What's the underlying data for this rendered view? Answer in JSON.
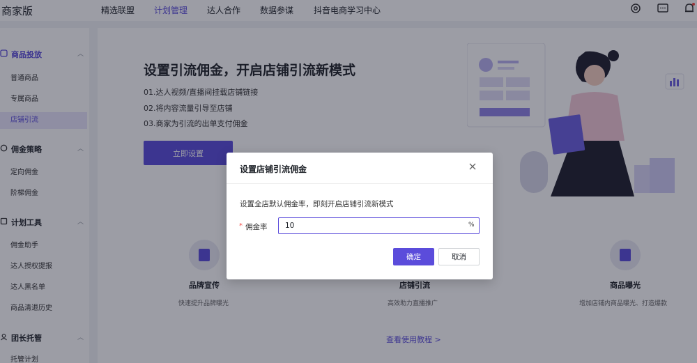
{
  "brand": "商家版",
  "nav": {
    "items": [
      {
        "label": "精选联盟",
        "active": false
      },
      {
        "label": "计划管理",
        "active": true
      },
      {
        "label": "达人合作",
        "active": false
      },
      {
        "label": "数据参谋",
        "active": false
      },
      {
        "label": "抖音电商学习中心",
        "active": false
      }
    ],
    "icons": [
      "gear-icon",
      "message-icon",
      "bell-icon"
    ]
  },
  "sidebar": {
    "groups": [
      {
        "label": "商品投放",
        "icon": "product-icon",
        "active": true,
        "items": [
          {
            "label": "普通商品"
          },
          {
            "label": "专属商品"
          },
          {
            "label": "店铺引流",
            "active": true
          }
        ]
      },
      {
        "label": "佣金策略",
        "icon": "commission-icon",
        "items": [
          {
            "label": "定向佣金"
          },
          {
            "label": "阶梯佣金"
          }
        ]
      },
      {
        "label": "计划工具",
        "icon": "tool-icon",
        "items": [
          {
            "label": "佣金助手"
          },
          {
            "label": "达人授权提报"
          },
          {
            "label": "达人黑名单"
          },
          {
            "label": "商品清退历史"
          }
        ]
      },
      {
        "label": "团长托管",
        "icon": "group-icon",
        "items": [
          {
            "label": "托管计划"
          }
        ]
      }
    ]
  },
  "hero": {
    "title": "设置引流佣金，开启店铺引流新模式",
    "steps": [
      "01.达人视频/直播间挂载店铺链接",
      "02.将内容流量引导至店铺",
      "03.商家为引流的出单支付佣金"
    ],
    "cta": "立即设置"
  },
  "features": [
    {
      "title": "品牌宣传",
      "desc": "快速提升品牌曝光"
    },
    {
      "title": "店铺引流",
      "desc": "高效助力直播推广"
    },
    {
      "title": "商品曝光",
      "desc": "增加店铺内商品曝光、打造爆款"
    }
  ],
  "tutorial_link": "查看使用教程 >",
  "modal": {
    "title": "设置店铺引流佣金",
    "description": "设置全店默认佣金率，即刻开启店铺引流新模式",
    "required_mark": "*",
    "field_label": "佣金率",
    "field_value": "10",
    "field_suffix": "%",
    "confirm": "确定",
    "cancel": "取消"
  },
  "colors": {
    "accent": "#5b4cdb",
    "overlay": "rgba(20,22,40,0.42)"
  }
}
